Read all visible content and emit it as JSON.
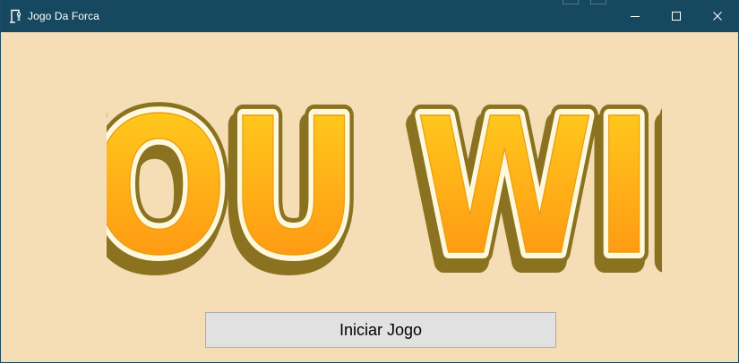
{
  "window": {
    "title": "Jogo Da Forca",
    "icon": "gallows-app-icon",
    "controls": [
      "minimize-icon",
      "maximize-icon",
      "close-icon"
    ],
    "colors": {
      "titlebar": "#16485f",
      "background": "#f5ddb5"
    }
  },
  "banner": {
    "text": "YOU WIN",
    "colors": {
      "fill_top": "#ffd21f",
      "fill_bottom": "#ff8d10",
      "inner_outline": "#fff8dc",
      "outer_outline": "#8a7220"
    }
  },
  "start_button": {
    "label": "Iniciar Jogo"
  }
}
